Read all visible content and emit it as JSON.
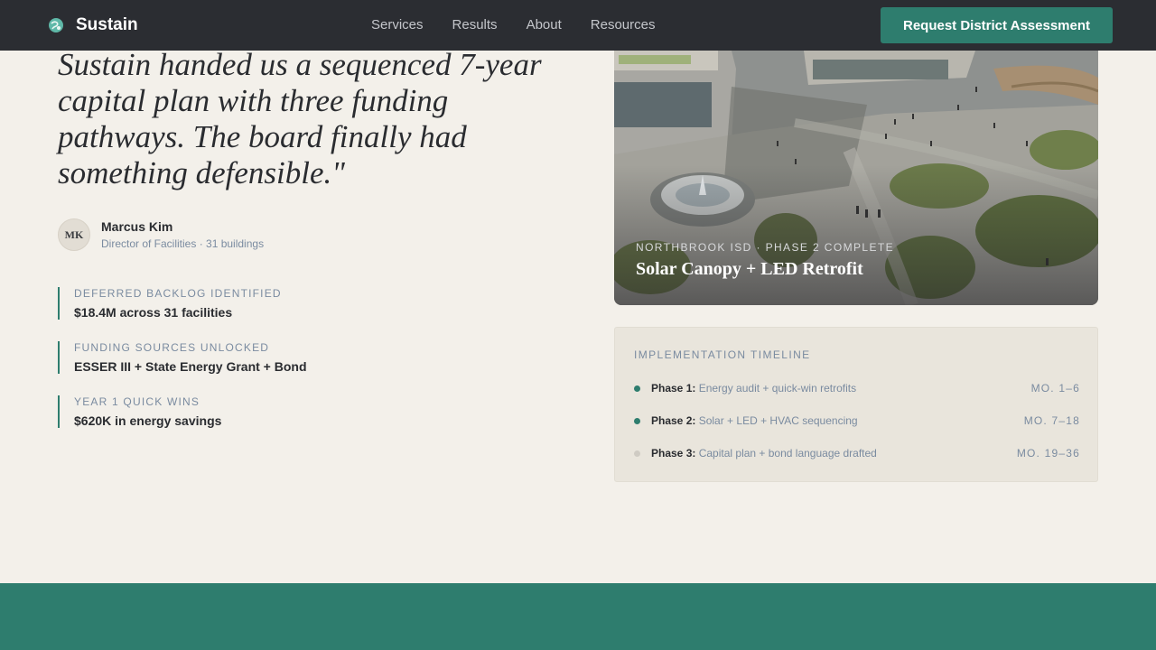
{
  "nav": {
    "brand": "Sustain",
    "links": [
      "Services",
      "Results",
      "About",
      "Resources"
    ],
    "cta": "Request District Assessment"
  },
  "testimonial": {
    "quote": "Sustain handed us a sequenced 7-year capital plan with three funding pathways. The board finally had something defensible.\"",
    "author": {
      "initials": "MK",
      "name": "Marcus Kim",
      "role": "Director of Facilities · 31 buildings"
    }
  },
  "stats": [
    {
      "label": "DEFERRED BACKLOG IDENTIFIED",
      "value": "$18.4M across 31 facilities"
    },
    {
      "label": "FUNDING SOURCES UNLOCKED",
      "value": "ESSER III + State Energy Grant + Bond"
    },
    {
      "label": "YEAR 1 QUICK WINS",
      "value": "$620K in energy savings"
    }
  ],
  "project": {
    "eyebrow": "NORTHBROOK ISD · PHASE 2 COMPLETE",
    "title": "Solar Canopy + LED Retrofit"
  },
  "timeline": {
    "title": "IMPLEMENTATION TIMELINE",
    "phases": [
      {
        "label": "Phase 1:",
        "desc": "Energy audit + quick-win retrofits",
        "months": "MO. 1–6",
        "status": "complete",
        "color": "#2e7d6e"
      },
      {
        "label": "Phase 2:",
        "desc": "Solar + LED + HVAC sequencing",
        "months": "MO. 7–18",
        "status": "complete",
        "color": "#2e7d6e"
      },
      {
        "label": "Phase 3:",
        "desc": "Capital plan + bond language drafted",
        "months": "MO. 19–36",
        "status": "pending",
        "color": "#cfcbc3"
      }
    ]
  },
  "colors": {
    "accent": "#2e7d6e",
    "nav_bg": "#2b2d32",
    "page_bg": "#f3f0ea",
    "muted": "#7a8ba0"
  },
  "icons": {
    "logo": "globe-leaf-icon"
  }
}
